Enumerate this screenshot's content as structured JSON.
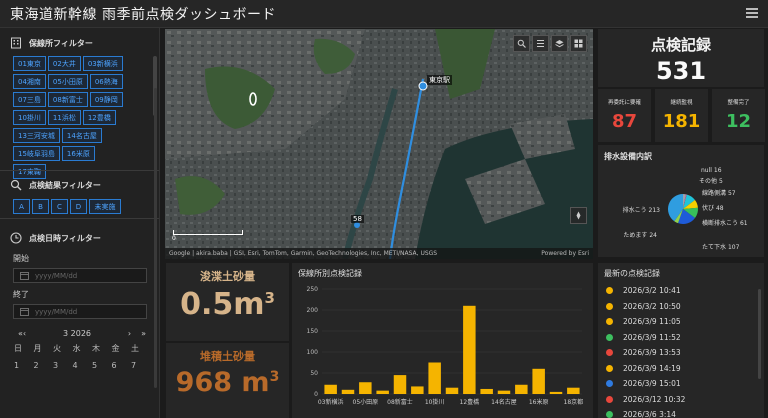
{
  "header": {
    "title": "東海道新幹線 雨季前点検ダッシュボード"
  },
  "filters": {
    "office_title": "保線所フィルター",
    "offices": [
      "01東京",
      "02大井",
      "03新横浜",
      "04湘南",
      "05小田原",
      "06熱海",
      "07三島",
      "08新富士",
      "09静岡",
      "10掛川",
      "11浜松",
      "12豊橋",
      "13三河安城",
      "14名古屋",
      "15岐阜羽島",
      "16米原",
      "17東鞠"
    ],
    "result_title": "点検結果フィルター",
    "results": [
      "A",
      "B",
      "C",
      "D",
      "未実施"
    ],
    "date_title": "点検日時フィルター",
    "start_label": "開始",
    "end_label": "終了",
    "date_placeholder": "yyyy/MM/dd",
    "calendar_month": "3 2026",
    "weekdays": [
      "日",
      "月",
      "火",
      "水",
      "木",
      "金",
      "土"
    ],
    "days": [
      "1",
      "2",
      "3",
      "4",
      "5",
      "6",
      "7"
    ]
  },
  "map": {
    "label_station": "東京駅",
    "label_code": "58",
    "attribution": "Google | akira.baba | GSI, Esri, TomTom, Garmin, GeoTechnologies, Inc, METI/NASA, USGS",
    "powered": "Powered by Esri",
    "scale": "0"
  },
  "records": {
    "title": "点検記録",
    "count": "531"
  },
  "kpis": [
    {
      "label": "再委託に要確",
      "value": "87",
      "color": "#e8473c"
    },
    {
      "label": "継続監視",
      "value": "181",
      "color": "#f5b400"
    },
    {
      "label": "整備完了",
      "value": "12",
      "color": "#3dbf5f"
    }
  ],
  "drainage": {
    "title": "排水設備内訳",
    "slices": [
      {
        "label": "null",
        "value": 16,
        "color": "#9aa4ad"
      },
      {
        "label": "その他",
        "value": 5,
        "color": "#e85aa0"
      },
      {
        "label": "線路側溝",
        "value": 57,
        "color": "#20c4d8"
      },
      {
        "label": "伏び",
        "value": 48,
        "color": "#f5d000"
      },
      {
        "label": "横断排水こう",
        "value": 61,
        "color": "#38c05a"
      },
      {
        "label": "たて下水",
        "value": 107,
        "color": "#1e5bd8"
      },
      {
        "label": "ためます",
        "value": 24,
        "color": "#8fd14f"
      },
      {
        "label": "排水こう",
        "value": 213,
        "color": "#2f9de0"
      }
    ]
  },
  "volumes": {
    "dredge_title": "浚渫土砂量",
    "dredge_value": "0.5m",
    "dredge_color": "#d6b48a",
    "accum_title": "堆積土砂量",
    "accum_value": "968 m",
    "accum_color": "#b86a2a",
    "unit_sup": "3"
  },
  "bar_chart": {
    "title": "保線所別点検記録"
  },
  "chart_data": {
    "type": "bar",
    "title": "保線所別点検記録",
    "categories": [
      "03新横浜",
      "",
      "05小田原",
      "",
      "08新富士",
      "",
      "10掛川",
      "",
      "12豊橋",
      "",
      "14名古屋",
      "",
      "16米原",
      "",
      "18京都"
    ],
    "values": [
      22,
      10,
      28,
      8,
      45,
      18,
      75,
      15,
      210,
      12,
      8,
      22,
      60,
      5,
      15
    ],
    "ylim": [
      0,
      250
    ],
    "yticks": [
      0,
      50,
      100,
      150,
      200,
      250
    ],
    "color": "#f5b400",
    "grid": true
  },
  "latest": {
    "title": "最新の点検記録",
    "items": [
      {
        "date": "2026/3/2 10:41",
        "color": "#f5b400"
      },
      {
        "date": "2026/3/2 10:50",
        "color": "#f5b400"
      },
      {
        "date": "2026/3/9 11:05",
        "color": "#f5b400"
      },
      {
        "date": "2026/3/9 11:52",
        "color": "#3dbf5f"
      },
      {
        "date": "2026/3/9 13:53",
        "color": "#e8473c"
      },
      {
        "date": "2026/3/9 14:19",
        "color": "#f5b400"
      },
      {
        "date": "2026/3/9 15:01",
        "color": "#2f7be0"
      },
      {
        "date": "2026/3/12 10:32",
        "color": "#e8473c"
      },
      {
        "date": "2026/3/6 3:14",
        "color": "#3dbf5f"
      }
    ]
  }
}
